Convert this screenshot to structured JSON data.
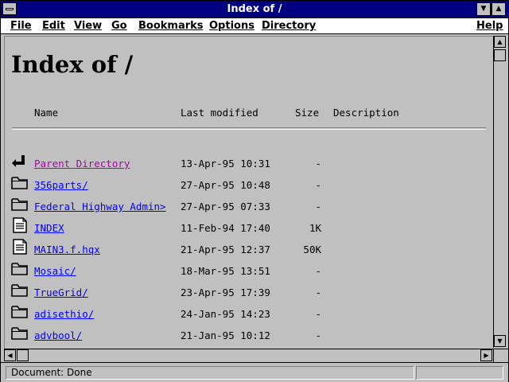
{
  "window": {
    "title": "Index of /",
    "minimize_glyph": "▼",
    "maximize_glyph": "▲"
  },
  "menu": [
    {
      "label": "File"
    },
    {
      "label": "Edit"
    },
    {
      "label": "View"
    },
    {
      "label": "Go"
    },
    {
      "label": "Bookmarks"
    },
    {
      "label": "Options"
    },
    {
      "label": "Directory"
    },
    {
      "label": "Help"
    }
  ],
  "page": {
    "heading": "Index of /",
    "columns": {
      "name": "Name",
      "modified": "Last modified",
      "size": "Size",
      "description": "Description"
    },
    "entries": [
      {
        "icon": "parent-arrow-icon",
        "name": "Parent Directory",
        "modified": "13-Apr-95 10:31",
        "size": "-",
        "visited": true
      },
      {
        "icon": "folder-icon",
        "name": "356parts/",
        "modified": "27-Apr-95 10:48",
        "size": "-",
        "visited": false
      },
      {
        "icon": "folder-icon",
        "name": "Federal Highway Admin>",
        "modified": "27-Apr-95 07:33",
        "size": "-",
        "visited": false
      },
      {
        "icon": "document-icon",
        "name": "INDEX",
        "modified": "11-Feb-94 17:40",
        "size": "1K",
        "visited": false
      },
      {
        "icon": "document-icon",
        "name": "MAIN3.f.hqx",
        "modified": "21-Apr-95 12:37",
        "size": "50K",
        "visited": false
      },
      {
        "icon": "folder-icon",
        "name": "Mosaic/",
        "modified": "18-Mar-95 13:51",
        "size": "-",
        "visited": false
      },
      {
        "icon": "folder-icon",
        "name": "TrueGrid/",
        "modified": "23-Apr-95 17:39",
        "size": "-",
        "visited": false
      },
      {
        "icon": "folder-icon",
        "name": "adisethio/",
        "modified": "24-Jan-95 14:23",
        "size": "-",
        "visited": false
      },
      {
        "icon": "folder-icon",
        "name": "advbool/",
        "modified": "21-Jan-95 10:12",
        "size": "-",
        "visited": false
      }
    ]
  },
  "status": {
    "text": "Document: Done"
  },
  "colors": {
    "titlebar": "#000080",
    "visited_link": "#b000b0",
    "unvisited_link": "#0000ff"
  }
}
